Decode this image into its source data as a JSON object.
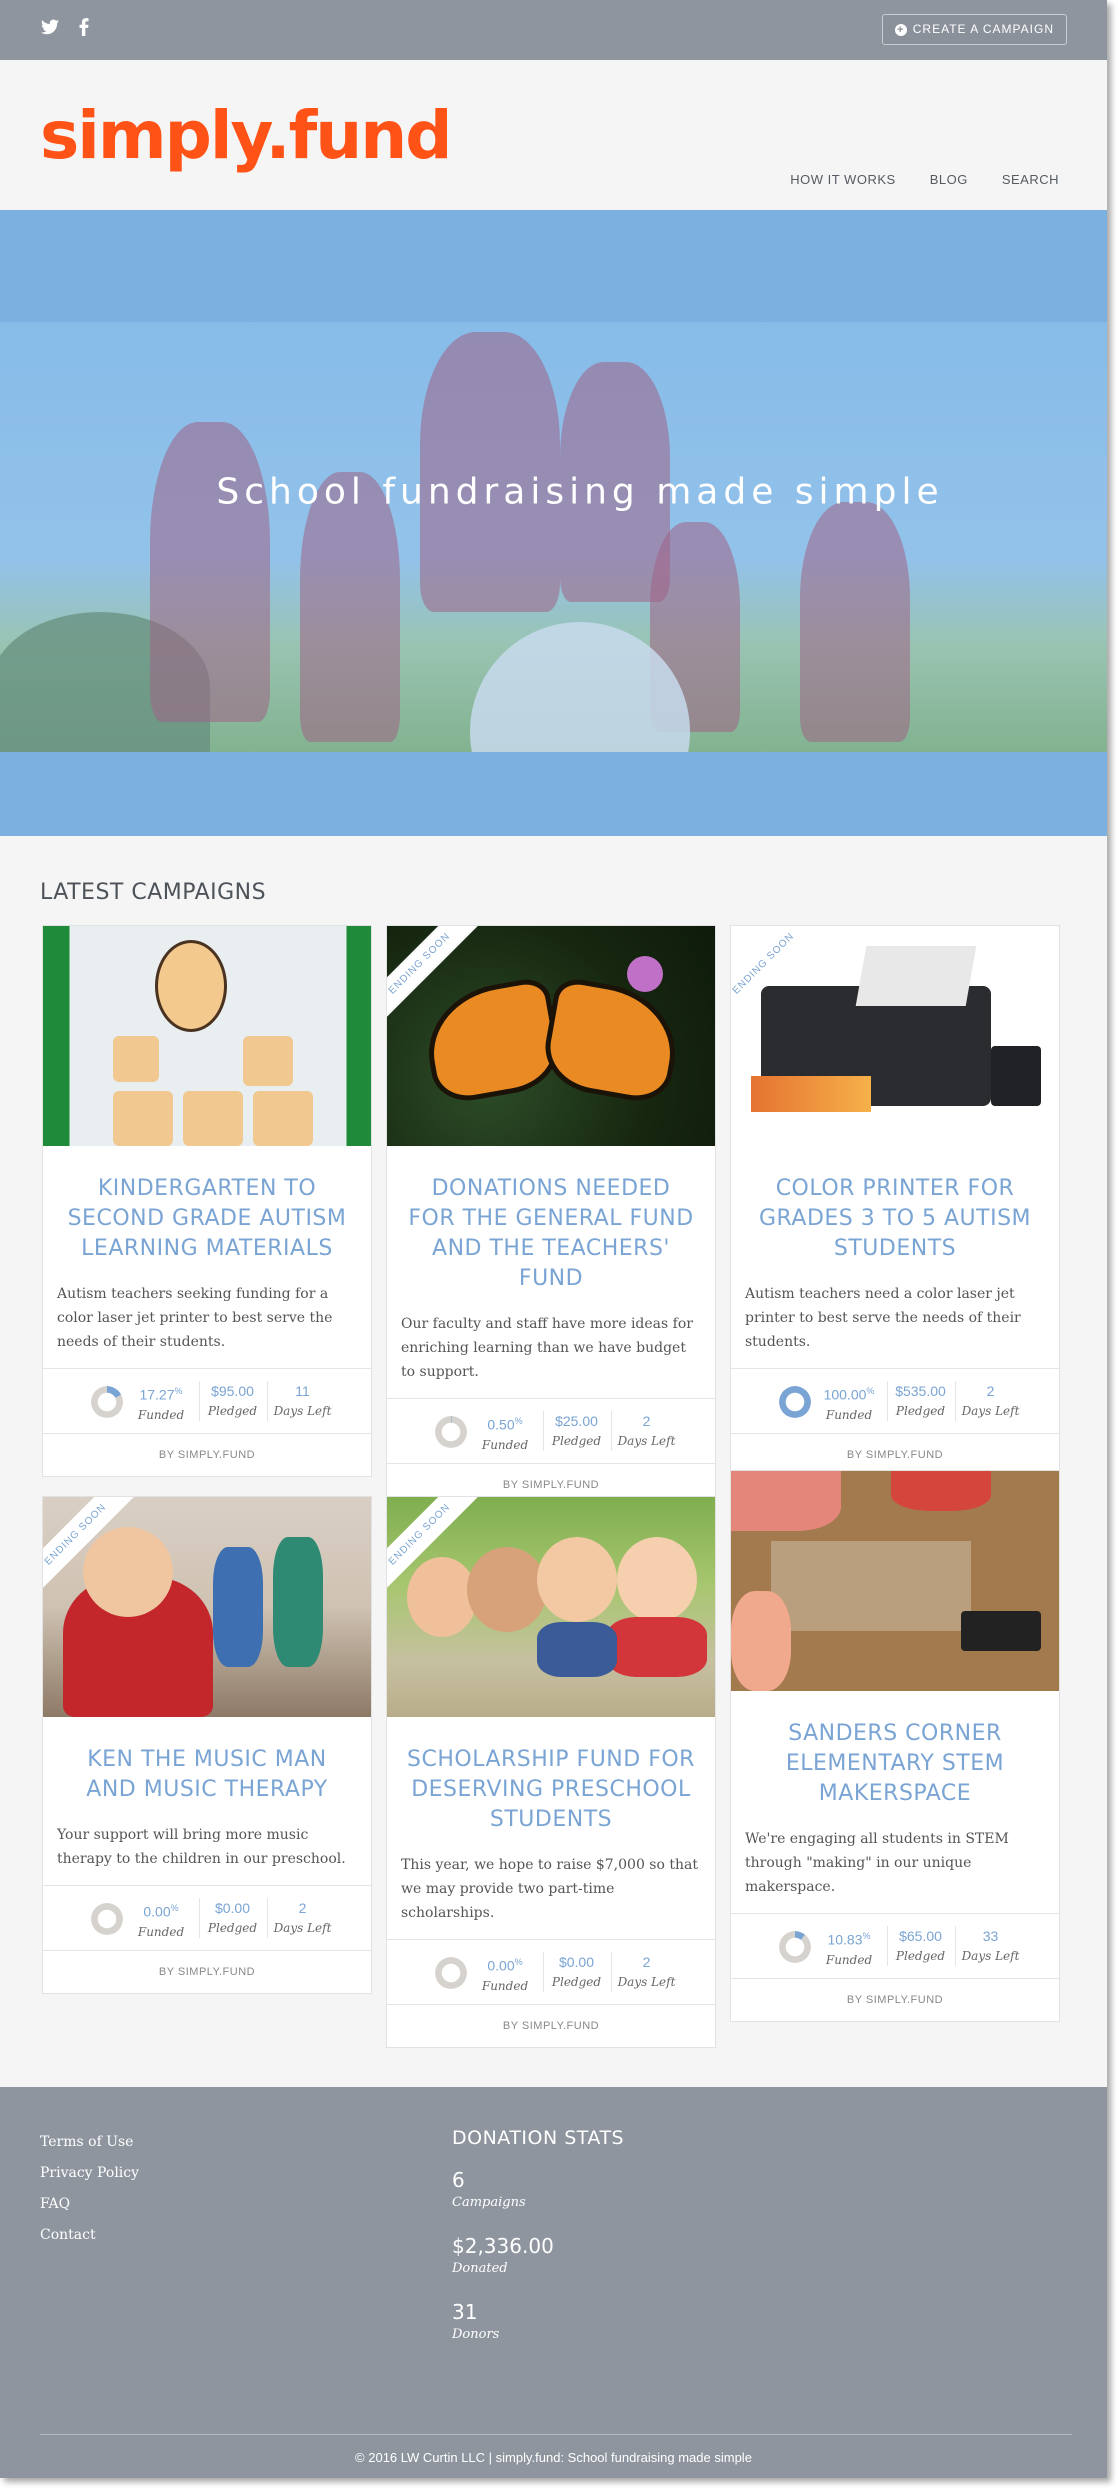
{
  "topbar": {
    "social": [
      {
        "icon": "twitter-icon",
        "glyph": "🐦"
      },
      {
        "icon": "facebook-icon",
        "glyph": "f"
      }
    ],
    "create_button": "CREATE A CAMPAIGN"
  },
  "header": {
    "logo": "simply.fund",
    "nav": [
      "HOW IT WORKS",
      "BLOG",
      "SEARCH"
    ]
  },
  "hero": {
    "title": "School fundraising made simple"
  },
  "campaigns": {
    "section_title": "LATEST CAMPAIGNS",
    "items": [
      {
        "title": "KINDERGARTEN TO SECOND GRADE AUTISM LEARNING MATERIALS",
        "ending_soon": false,
        "description": "Autism teachers seeking funding for a color laser jet printer to best serve the needs of their students.",
        "funded": "17.27",
        "funded_fraction": 0.1727,
        "pledged": "$95.00",
        "days_left": "11",
        "by": "BY SIMPLY.FUND"
      },
      {
        "title": "DONATIONS NEEDED FOR THE GENERAL FUND AND THE TEACHERS' FUND",
        "ending_soon": true,
        "description": "Our faculty and staff have more ideas for enriching learning than we have budget to support.",
        "funded": "0.50",
        "funded_fraction": 0.005,
        "pledged": "$25.00",
        "days_left": "2",
        "by": "BY SIMPLY.FUND"
      },
      {
        "title": "COLOR PRINTER FOR GRADES 3 TO 5 AUTISM STUDENTS",
        "ending_soon": true,
        "description": "Autism teachers need a color laser jet printer to best serve the needs of their students.",
        "funded": "100.00",
        "funded_fraction": 1.0,
        "pledged": "$535.00",
        "days_left": "2",
        "by": "BY SIMPLY.FUND"
      },
      {
        "title": "KEN THE MUSIC MAN AND MUSIC THERAPY",
        "ending_soon": true,
        "description": "Your support will bring more music therapy to the children in our preschool.",
        "funded": "0.00",
        "funded_fraction": 0.0,
        "pledged": "$0.00",
        "days_left": "2",
        "by": "BY SIMPLY.FUND"
      },
      {
        "title": "SCHOLARSHIP FUND FOR DESERVING PRESCHOOL STUDENTS",
        "ending_soon": true,
        "description": "This year, we hope to raise $7,000 so that we may provide two part-time scholarships.",
        "funded": "0.00",
        "funded_fraction": 0.0,
        "pledged": "$0.00",
        "days_left": "2",
        "by": "BY SIMPLY.FUND"
      },
      {
        "title": "SANDERS CORNER ELEMENTARY STEM MAKERSPACE",
        "ending_soon": false,
        "description": "We're engaging all students in STEM through \"making\" in our unique makerspace.",
        "funded": "10.83",
        "funded_fraction": 0.1083,
        "pledged": "$65.00",
        "days_left": "33",
        "by": "BY SIMPLY.FUND"
      }
    ],
    "labels": {
      "funded": "Funded",
      "pledged": "Pledged",
      "days_left": "Days Left",
      "percent": "%",
      "ending_soon": "ENDING SOON"
    }
  },
  "footer": {
    "links": [
      "Terms of Use",
      "Privacy Policy",
      "FAQ",
      "Contact"
    ],
    "stats_title": "DONATION STATS",
    "stats": [
      {
        "value": "6",
        "label": "Campaigns"
      },
      {
        "value": "$2,336.00",
        "label": "Donated"
      },
      {
        "value": "31",
        "label": "Donors"
      }
    ],
    "copyright": "© 2016 LW Curtin LLC | simply.fund: School fundraising made simple"
  },
  "colors": {
    "brand": "#ff5216",
    "accent": "#7aa4d4",
    "bar": "#8e959e"
  }
}
